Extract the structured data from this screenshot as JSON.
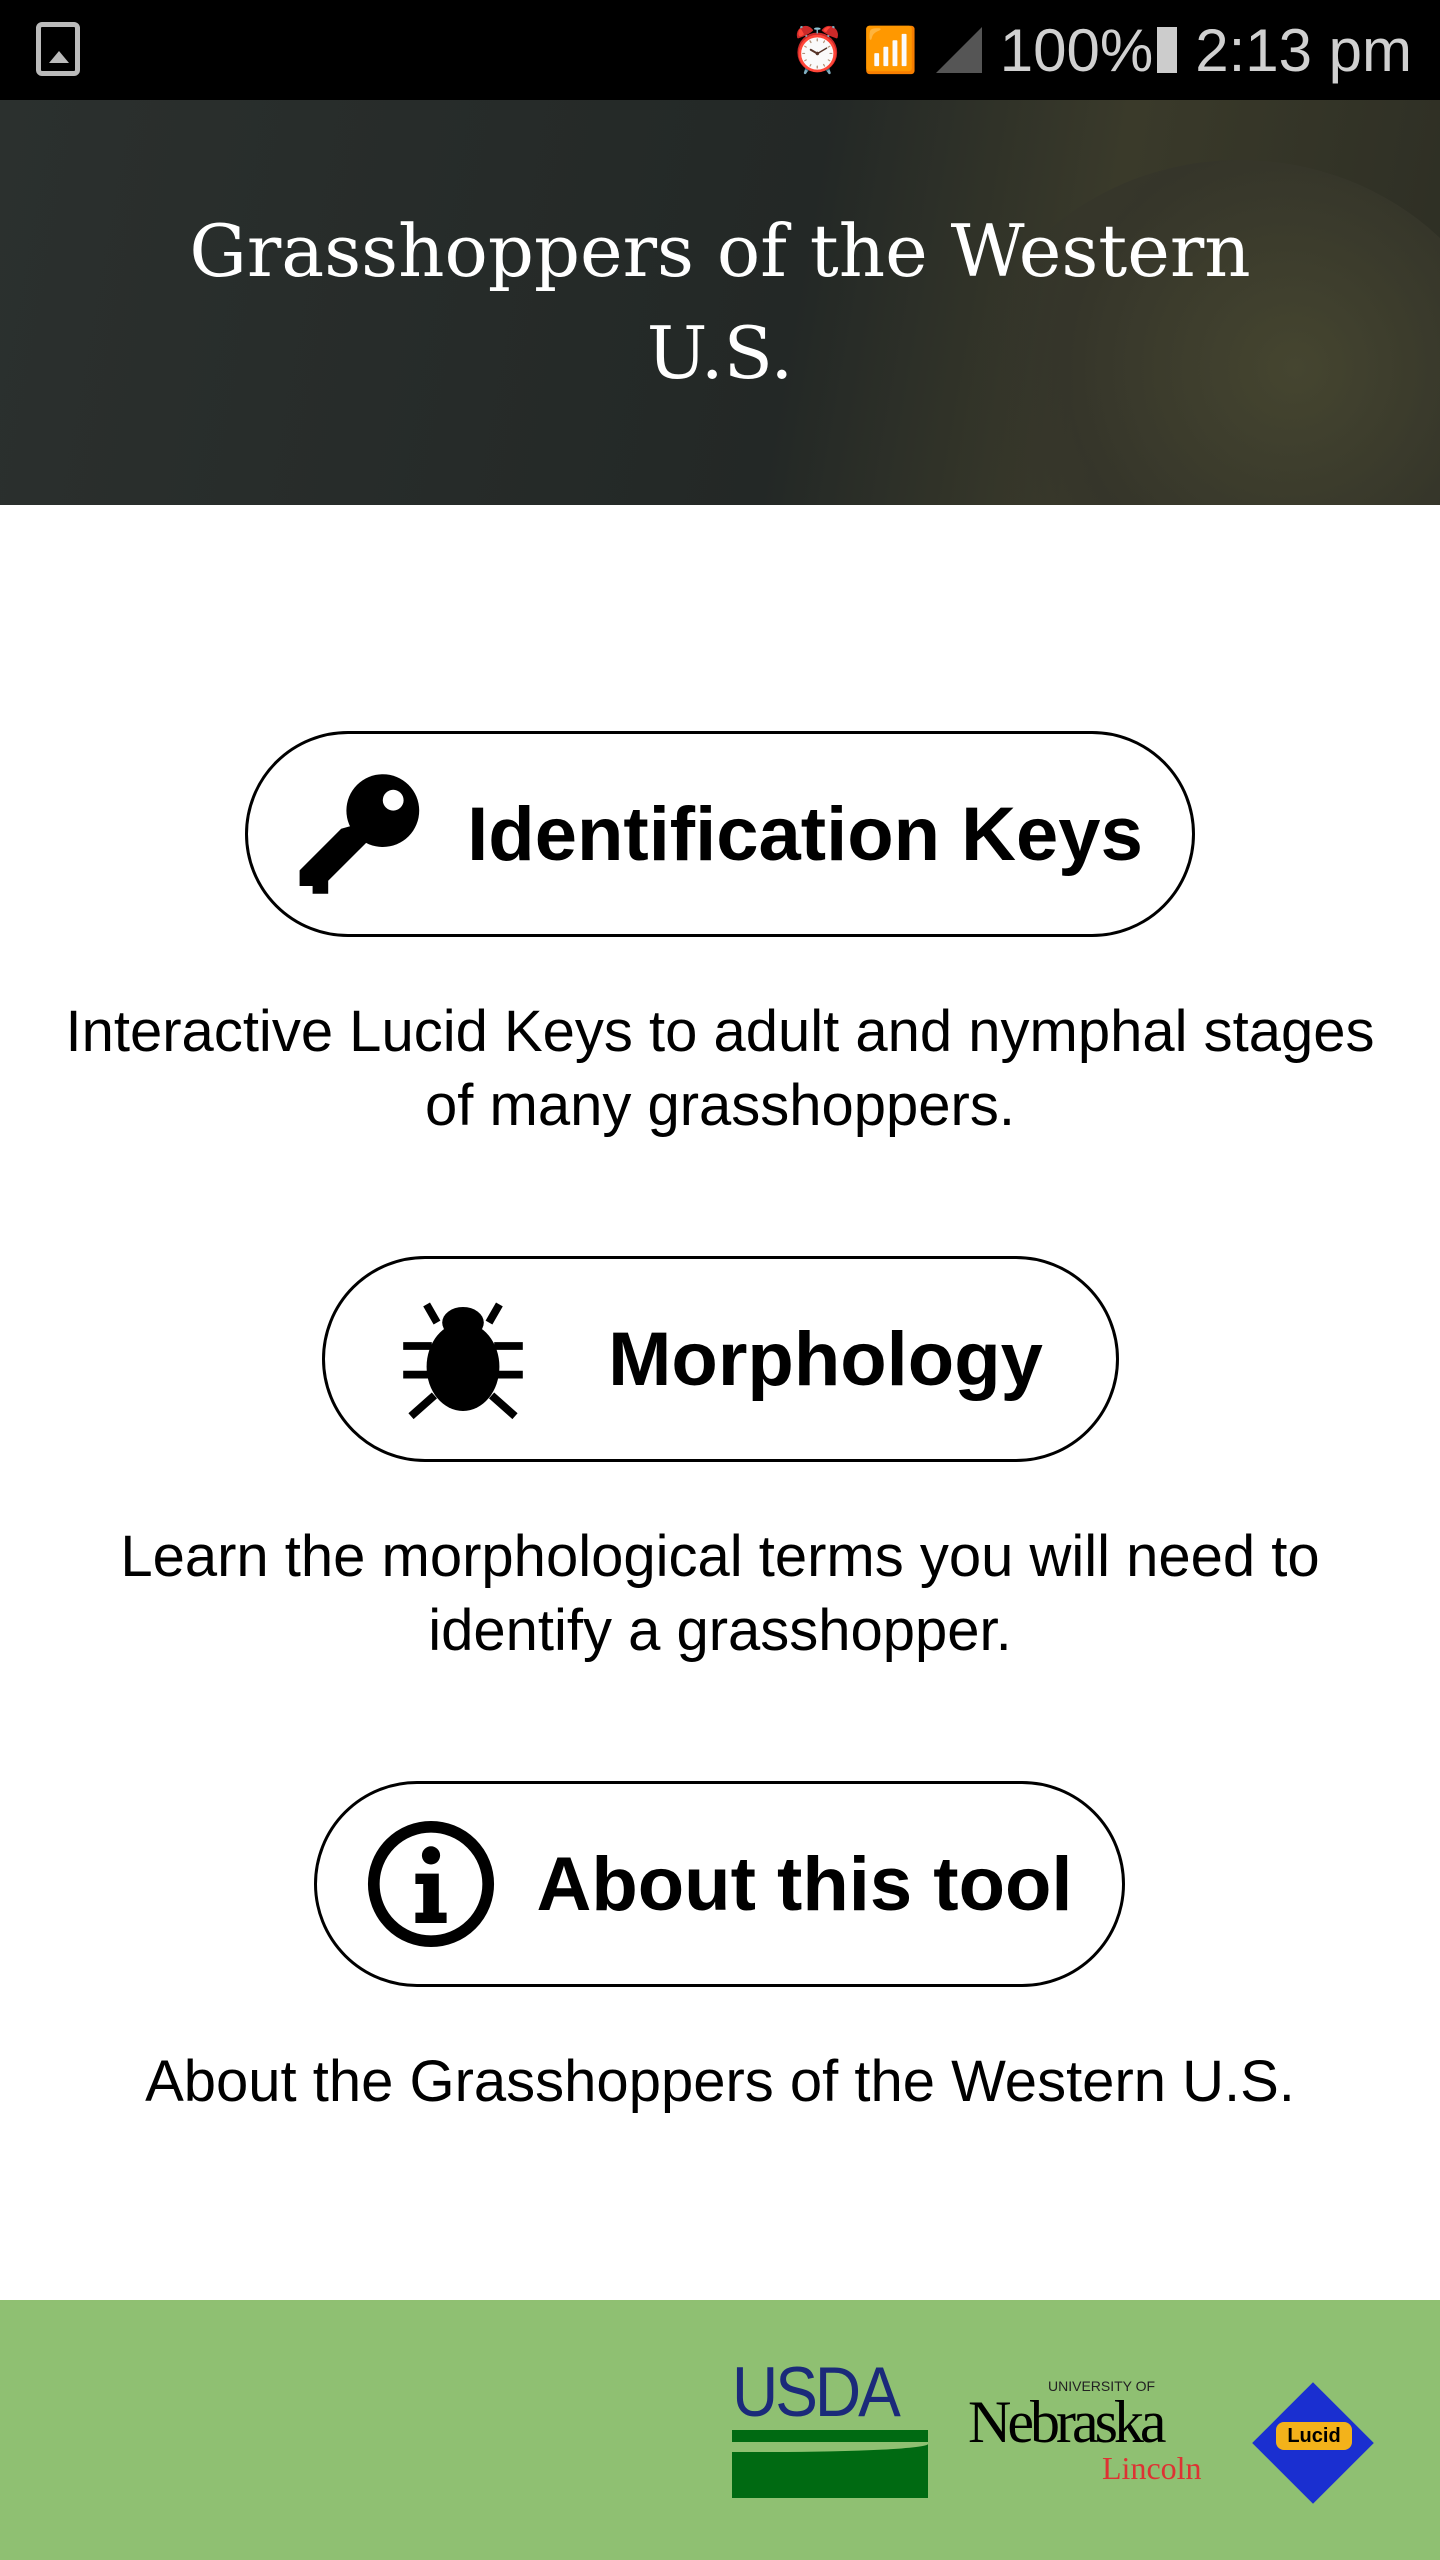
{
  "status_bar": {
    "battery": "100%",
    "time": "2:13 pm",
    "icons": [
      "gallery-icon",
      "alarm-icon",
      "wifi-icon",
      "signal-icon",
      "battery-charging-icon"
    ]
  },
  "header": {
    "title": "Grasshoppers of the Western U.S."
  },
  "menu": [
    {
      "label": "Identification Keys",
      "icon": "key-icon",
      "description": "Interactive Lucid Keys to adult and nymphal stages of many grasshoppers."
    },
    {
      "label": "Morphology",
      "icon": "bug-icon",
      "description": "Learn the morphological terms you will need to identify a grasshopper."
    },
    {
      "label": "About this tool",
      "icon": "info-icon",
      "description": "About the Grasshoppers of the Western U.S."
    }
  ],
  "footer": {
    "logos": [
      "USDA",
      "University of Nebraska Lincoln",
      "Lucid"
    ],
    "background": "#8fc072"
  }
}
